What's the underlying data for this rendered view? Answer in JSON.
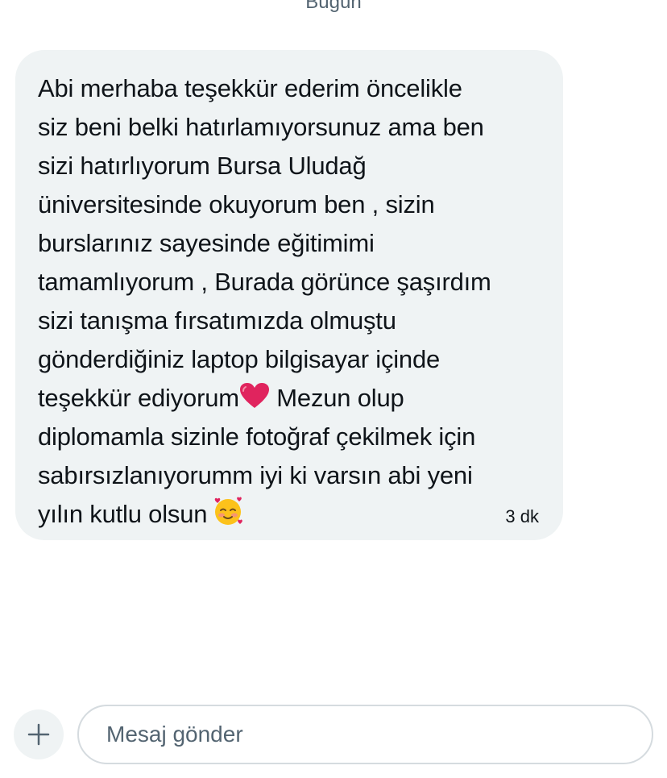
{
  "date_divider": "Bugün",
  "message": {
    "lines": [
      "Abi merhaba teşekkür ederim öncelikle",
      "siz beni belki hatırlamıyorsunuz ama ben",
      "sizi hatırlıyorum Bursa Uludağ",
      "üniversitesinde okuyorum ben , sizin",
      "burslarınız sayesinde eğitimimi",
      "tamamlıyorum , Burada görünce şaşırdım",
      "sizi tanışma fırsatımızda olmuştu",
      "gönderdiğiniz laptop bilgisayar içinde"
    ],
    "line_9_before_emoji": "teşekkür ediyorum",
    "line_9_after_emoji": " Mezun olup",
    "line_10": "diplomamla sizinle fotoğraf çekilmek için",
    "line_11": "sabırsızlanıyorumm iyi ki varsın abi yeni",
    "line_12": "yılın kutlu olsun",
    "emoji_1": "red-heart",
    "emoji_2": "smiling-face-with-hearts",
    "timestamp": "3 dk"
  },
  "composer": {
    "placeholder": "Mesaj gönder",
    "add_icon": "plus-icon"
  },
  "colors": {
    "bubble_bg": "#eff3f4",
    "text": "#0f1419",
    "muted": "#536471",
    "heart": "#e0245e",
    "border": "#d5dbdf"
  }
}
